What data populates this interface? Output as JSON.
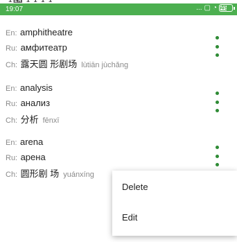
{
  "status_bar": {
    "time": "19:07",
    "icons": [
      "dots-icon",
      "sim-icon",
      "wifi-icon",
      "battery-icon"
    ],
    "dots": "...",
    "battery_level": "49",
    "color": "#4caf50"
  },
  "words": [
    {
      "en_tag": "En:",
      "en": "amphitheatre",
      "ru_tag": "Ru:",
      "ru": "амфитеатр",
      "ch_tag": "Ch:",
      "ch": "露天圆 形剧场",
      "pinyin": "lùtiān jùchǎng"
    },
    {
      "en_tag": "En:",
      "en": "analysis",
      "ru_tag": "Ru:",
      "ru": "анализ",
      "ch_tag": "Ch:",
      "ch": "分析",
      "pinyin": "fēnxī"
    },
    {
      "en_tag": "En:",
      "en": "arena",
      "ru_tag": "Ru:",
      "ru": "арена",
      "ch_tag": "Ch:",
      "ch": "圆形剧 场",
      "pinyin": "yuánxíng"
    }
  ],
  "context_menu": {
    "items": [
      "Delete",
      "Edit"
    ]
  },
  "accent": "#2e8b35"
}
